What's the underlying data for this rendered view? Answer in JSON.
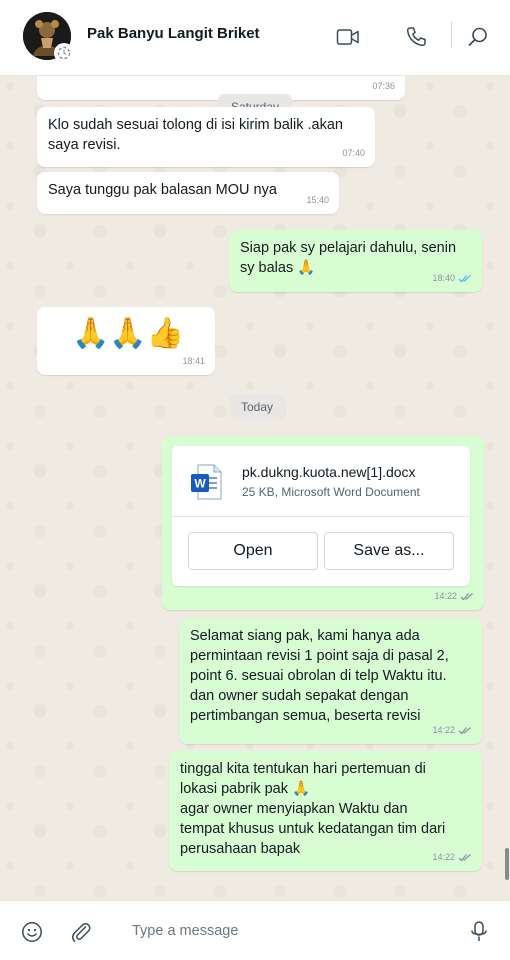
{
  "header": {
    "contact_name": "Pak Banyu Langit Briket"
  },
  "messages": {
    "m0": {
      "time": "07:36"
    },
    "date_saturday": "Saturday",
    "m1": {
      "lines": [
        "Klo sudah sesuai tolong di isi kirim balik .akan",
        "saya revisi."
      ],
      "time": "07:40"
    },
    "m2": {
      "lines": [
        "Saya tunggu pak balasan MOU nya"
      ],
      "time": "15:40"
    },
    "m3": {
      "lines": [
        "Siap pak sy pelajari dahulu, senin",
        "sy balas 🙏"
      ],
      "time": "18:40"
    },
    "m4": {
      "emoji": "🙏🙏👍",
      "time": "18:41"
    },
    "date_today": "Today",
    "m5": {
      "file_name": "pk.dukng.kuota.new[1].docx",
      "file_meta": "25 KB, Microsoft Word Document",
      "open_label": "Open",
      "save_label": "Save as...",
      "time": "14:22"
    },
    "m6": {
      "lines": [
        "Selamat siang pak, kami hanya ada",
        "permintaan revisi 1 point saja di pasal 2,",
        "point 6. sesuai obrolan di telp Waktu itu.",
        "dan owner sudah sepakat dengan",
        "pertimbangan semua, beserta revisi"
      ],
      "time": "14:22"
    },
    "m7": {
      "lines": [
        "tinggal kita tentukan hari pertemuan di",
        "lokasi pabrik pak 🙏",
        "agar owner menyiapkan Waktu dan",
        "tempat khusus untuk kedatangan tim dari",
        "perusahaan bapak"
      ],
      "time": "14:22"
    }
  },
  "composer": {
    "placeholder": "Type a message"
  },
  "icons": {
    "video": "video-call-icon",
    "voice": "voice-call-icon",
    "search": "search-icon",
    "emoji": "emoji-icon",
    "attach": "attach-icon",
    "mic": "microphone-icon",
    "read": "double-check-icon",
    "doc": "word-document-icon"
  },
  "colors": {
    "incoming_bubble": "#ffffff",
    "outgoing_bubble": "#d9fdd3",
    "chat_background": "#efeae2",
    "read_tick": "#53bdeb"
  }
}
